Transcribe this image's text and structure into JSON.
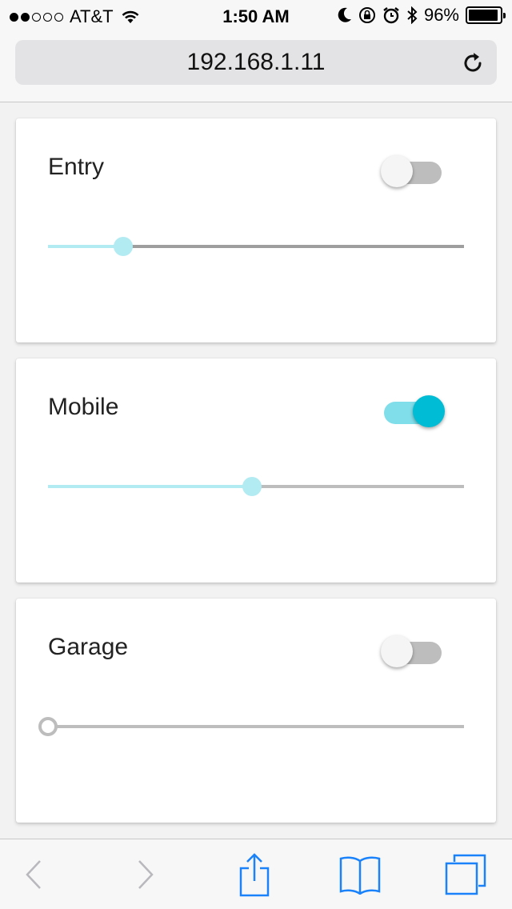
{
  "status_bar": {
    "carrier": "AT&T",
    "signal_dots_filled": 2,
    "signal_dots_total": 5,
    "time": "1:50 AM",
    "battery_percent": "96%",
    "battery_level": 0.96,
    "icons": [
      "wifi-icon",
      "moon-icon",
      "rotation-lock-icon",
      "alarm-icon",
      "bluetooth-icon",
      "battery-icon"
    ]
  },
  "browser": {
    "url": "192.168.1.11",
    "reload_icon": "reload-icon"
  },
  "devices": [
    {
      "name": "Entry",
      "on": false,
      "level": 0.18
    },
    {
      "name": "Mobile",
      "on": true,
      "level": 0.49
    },
    {
      "name": "Garage",
      "on": false,
      "level": 0.0
    }
  ],
  "toolbar": {
    "buttons": [
      "back-icon",
      "forward-icon",
      "share-icon",
      "bookmarks-icon",
      "tabs-icon"
    ]
  },
  "colors": {
    "accent": "#00bcd4",
    "accent_light": "#b2ebf2",
    "toggle_on_track": "#80deea",
    "toggle_off_track": "#bdbdbd",
    "toggle_off_knob": "#f5f5f5",
    "ios_blue": "#1a82fb",
    "ios_disabled": "#b8b8bd"
  }
}
